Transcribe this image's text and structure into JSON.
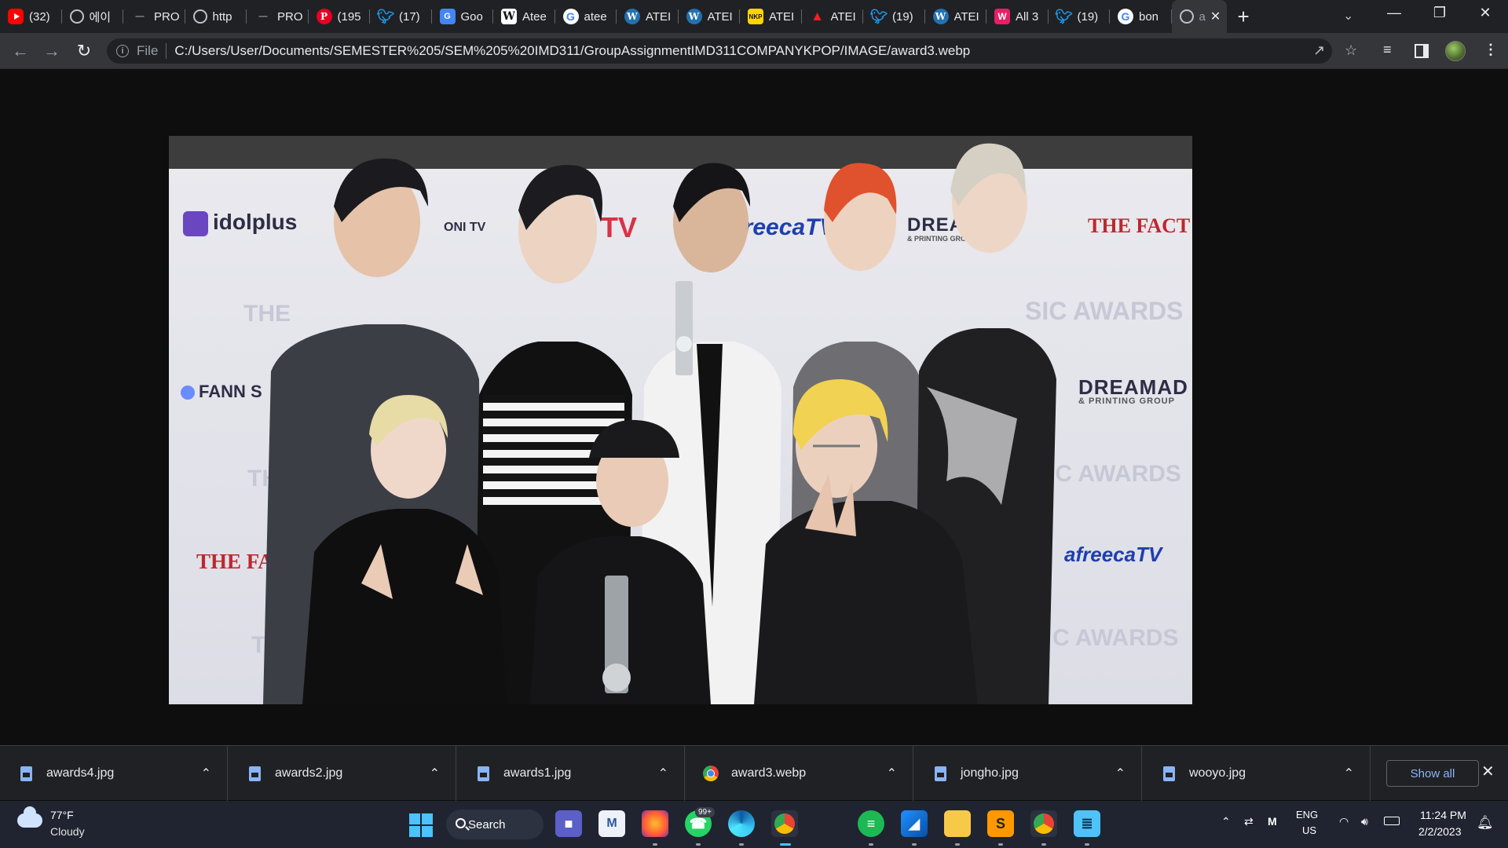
{
  "browser": {
    "tabs": [
      {
        "favicon": "youtube-icon",
        "label": "(32)"
      },
      {
        "favicon": "globe-icon",
        "label": "에이"
      },
      {
        "favicon": "dash-icon",
        "label": "PRO"
      },
      {
        "favicon": "globe-icon",
        "label": "http"
      },
      {
        "favicon": "dash-icon",
        "label": "PRO"
      },
      {
        "favicon": "pinterest-icon",
        "label": "(195"
      },
      {
        "favicon": "twitter-icon",
        "label": "(17)"
      },
      {
        "favicon": "google-translate-icon",
        "label": "Goo"
      },
      {
        "favicon": "wikipedia-icon",
        "label": "Atee"
      },
      {
        "favicon": "google-icon",
        "label": "atee"
      },
      {
        "favicon": "wordpress-icon",
        "label": "ATEI"
      },
      {
        "favicon": "wordpress-icon",
        "label": "ATEI"
      },
      {
        "favicon": "nkp-icon",
        "label": "ATEI"
      },
      {
        "favicon": "adobe-icon",
        "label": "ATEI"
      },
      {
        "favicon": "twitter-icon",
        "label": "(19)"
      },
      {
        "favicon": "wordpress-icon",
        "label": "ATEI"
      },
      {
        "favicon": "wf-icon",
        "label": "All 3"
      },
      {
        "favicon": "twitter-icon",
        "label": "(19)"
      },
      {
        "favicon": "google-icon",
        "label": "bon"
      }
    ],
    "active_tab": {
      "favicon": "globe-icon",
      "label": "a"
    },
    "address": {
      "scheme": "File",
      "url": "C:/Users/User/Documents/SEMESTER%205/SEM%205%20IMD311/GroupAssignmentIMD311COMPANYKPOP/IMAGE/award3.webp"
    }
  },
  "photo": {
    "wall_text": {
      "idolplus": "idolplus",
      "onitv": "ONI TV",
      "tv_red": "TV",
      "afreeca_top": "afreecaTV",
      "dreamad_top": "DREAMAD",
      "dreamad_sub_top": "& PRINTING GROUP",
      "the_fact_top": "THE FACT",
      "music_awards_1": "SIC AWARDS",
      "the_left_1": "THE",
      "fan_s": "FANN S",
      "dreamad_right": "DREAMAD",
      "dreamad_right_sub": "& PRINTING GROUP",
      "the_left_2": "THE",
      "music_awards_2": "SIC AWARDS",
      "the_fact_left": "THE FACT",
      "afreeca_right": "afreecaTV",
      "the_left_3": "THE",
      "music_awards_3": "C AWARDS"
    }
  },
  "downloads": {
    "items": [
      {
        "icon": "image-file-icon",
        "name": "awards4.jpg"
      },
      {
        "icon": "image-file-icon",
        "name": "awards2.jpg"
      },
      {
        "icon": "image-file-icon",
        "name": "awards1.jpg"
      },
      {
        "icon": "chrome-icon",
        "name": "award3.webp"
      },
      {
        "icon": "image-file-icon",
        "name": "jongho.jpg"
      },
      {
        "icon": "image-file-icon",
        "name": "wooyo.jpg"
      }
    ],
    "show_all": "Show all"
  },
  "taskbar": {
    "weather": {
      "temp": "77°F",
      "condition": "Cloudy"
    },
    "search_label": "Search",
    "whatsapp_badge": "99+",
    "lang_line1": "ENG",
    "lang_line2": "US",
    "time": "11:24 PM",
    "date": "2/2/2023"
  }
}
